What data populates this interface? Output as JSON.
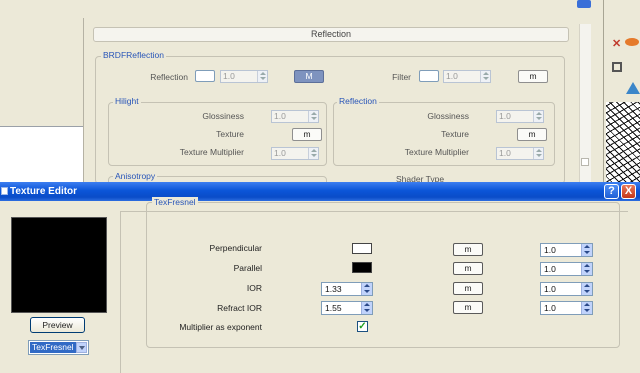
{
  "background": {
    "reflection_header": "Reflection",
    "brdf_group_title": "BRDFReflection",
    "reflection_label": "Reflection",
    "reflection_value": "1.0",
    "reflection_map_button": "M",
    "filter_label": "Filter",
    "filter_value": "1.0",
    "filter_map_button": "m",
    "hilight": {
      "title": "Hilight",
      "glossiness_label": "Glossiness",
      "glossiness_value": "1.0",
      "texture_label": "Texture",
      "texture_button": "m",
      "multiplier_label": "Texture Multiplier",
      "multiplier_value": "1.0"
    },
    "reflection_group": {
      "title": "Reflection",
      "glossiness_label": "Glossiness",
      "glossiness_value": "1.0",
      "texture_label": "Texture",
      "texture_button": "m",
      "multiplier_label": "Texture Multiplier",
      "multiplier_value": "1.0"
    },
    "anisotropy_title": "Anisotropy",
    "shader_type_label": "Shader Type"
  },
  "texture_editor": {
    "title": "Texture Editor",
    "help_button": "?",
    "close_button": "X",
    "preview_button": "Preview",
    "texture_type_selected": "TexFresnel",
    "group_title": "TexFresnel",
    "rows": [
      {
        "label": "Perpendicular",
        "swatch_color": "#ffffff",
        "map_button": "m",
        "multiplier": "1.0"
      },
      {
        "label": "Parallel",
        "swatch_color": "#000000",
        "map_button": "m",
        "multiplier": "1.0"
      },
      {
        "label": "IOR",
        "value": "1.33",
        "map_button": "m",
        "multiplier": "1.0"
      },
      {
        "label": "Refract IOR",
        "value": "1.55",
        "map_button": "m",
        "multiplier": "1.0"
      }
    ],
    "multiplier_as_exponent_label": "Multiplier as exponent",
    "multiplier_as_exponent_checked": true,
    "checkmark": "✓"
  }
}
